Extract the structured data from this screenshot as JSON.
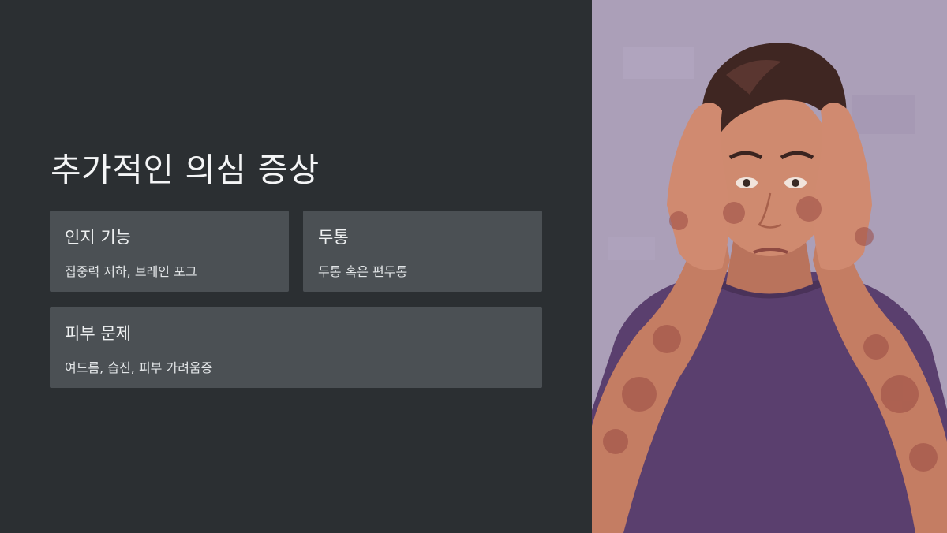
{
  "slide": {
    "title": "추가적인 의심 증상",
    "cards": [
      {
        "title": "인지 기능",
        "desc": "집중력 저하, 브레인 포그"
      },
      {
        "title": "두통",
        "desc": "두통 혹은 편두통"
      },
      {
        "title": "피부 문제",
        "desc": "여드름, 습진, 피부 가려움증"
      }
    ]
  },
  "illustration": {
    "subject": "distressed-young-man-with-skin-rash",
    "colors": {
      "background": "#ab9fb8",
      "shirt": "#5a3f6e",
      "skin": "#c9846a",
      "hair": "#3f2622",
      "rash": "#9a4b44"
    }
  }
}
